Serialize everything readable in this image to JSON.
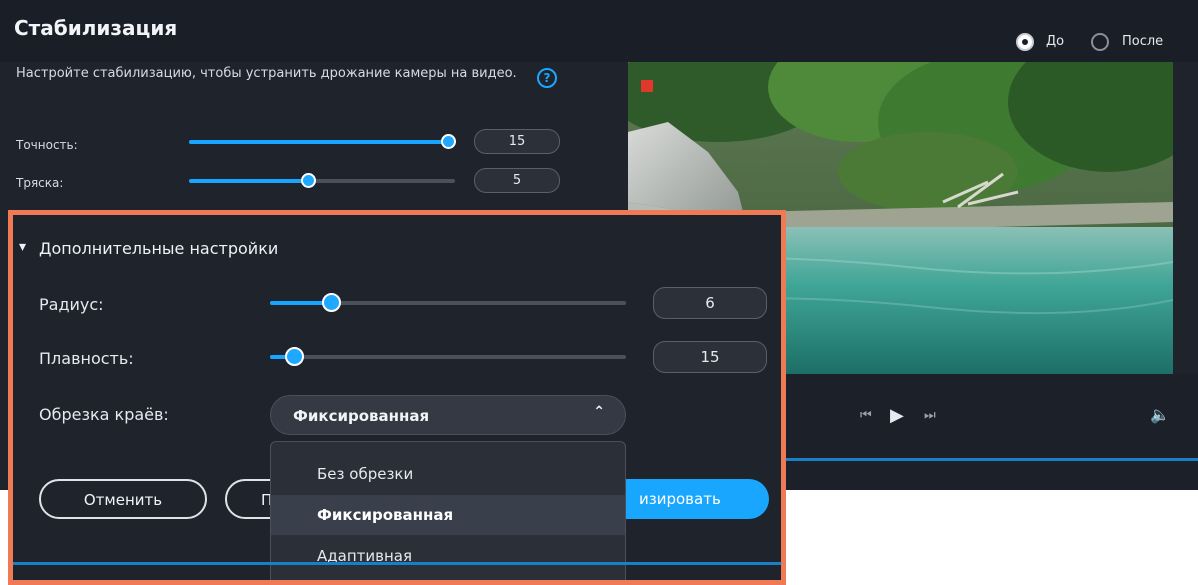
{
  "header": {
    "title": "Стабилизация",
    "radio_before": "До",
    "radio_after": "После"
  },
  "description": "Настройте стабилизацию, чтобы устранить дрожание камеры на видео.",
  "help_icon": "?",
  "sliders": [
    {
      "label": "Точность:",
      "value": "15",
      "level": 1.0
    },
    {
      "label": "Тряска:",
      "value": "5",
      "level": 0.45
    }
  ],
  "advanced": {
    "title": "Дополнительные настройки",
    "chevron": "▾",
    "radius": {
      "label": "Радиус:",
      "value": "6",
      "level": 0.18
    },
    "smoothness": {
      "label": "Плавность:",
      "value": "15",
      "level": 0.07
    },
    "crop": {
      "label": "Обрезка краёв:",
      "selected": "Фиксированная",
      "arrow": "⌃",
      "options": [
        "Без обрезки",
        "Фиксированная",
        "Адаптивная"
      ]
    }
  },
  "buttons": {
    "cancel": "Отменить",
    "apply_partial": "П",
    "stabilize_partial": "изировать"
  },
  "player": {
    "prev": "⏮",
    "play": "▶",
    "next": "⏭",
    "volume": "🔈"
  },
  "colors": {
    "accent": "#19a6ff",
    "highlight_border": "#f07a55",
    "background": "#1f232c"
  }
}
